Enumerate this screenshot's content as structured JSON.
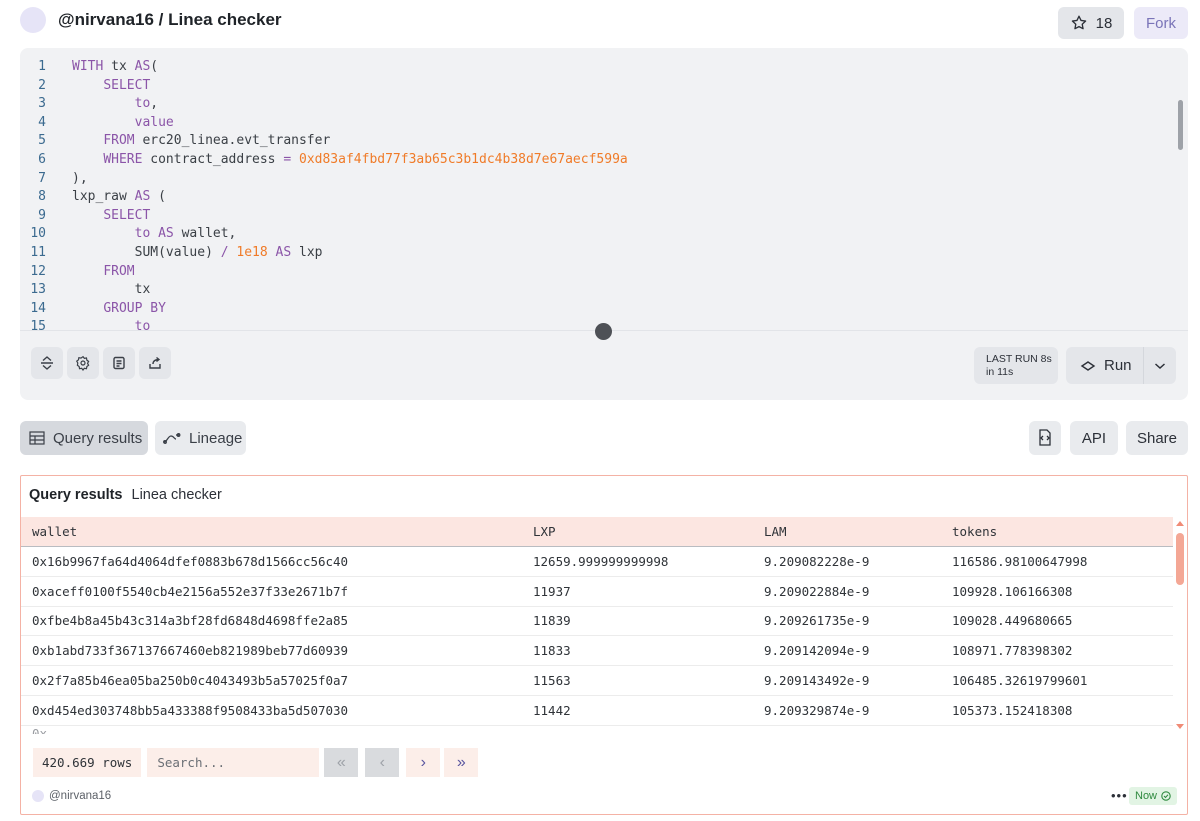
{
  "header": {
    "title": "@nirvana16 / Linea checker",
    "star_count": "18",
    "fork_label": "Fork"
  },
  "editor": {
    "lines": [
      {
        "n": "1",
        "parts": [
          {
            "t": "WITH",
            "c": "kw"
          },
          {
            "t": " tx ",
            "c": ""
          },
          {
            "t": "AS",
            "c": "kw"
          },
          {
            "t": "(",
            "c": ""
          }
        ]
      },
      {
        "n": "2",
        "parts": [
          {
            "t": "    ",
            "c": ""
          },
          {
            "t": "SELECT",
            "c": "kw"
          }
        ]
      },
      {
        "n": "3",
        "parts": [
          {
            "t": "        ",
            "c": ""
          },
          {
            "t": "to",
            "c": "kw"
          },
          {
            "t": ",",
            "c": ""
          }
        ]
      },
      {
        "n": "4",
        "parts": [
          {
            "t": "        ",
            "c": ""
          },
          {
            "t": "value",
            "c": "kw"
          }
        ]
      },
      {
        "n": "5",
        "parts": [
          {
            "t": "    ",
            "c": ""
          },
          {
            "t": "FROM",
            "c": "kw"
          },
          {
            "t": " erc20_linea.evt_transfer",
            "c": ""
          }
        ]
      },
      {
        "n": "6",
        "parts": [
          {
            "t": "    ",
            "c": ""
          },
          {
            "t": "WHERE",
            "c": "kw"
          },
          {
            "t": " contract_address ",
            "c": ""
          },
          {
            "t": "=",
            "c": "kw"
          },
          {
            "t": " ",
            "c": ""
          },
          {
            "t": "0xd83af4fbd77f3ab65c3b1dc4b38d7e67aecf599a",
            "c": "num"
          }
        ]
      },
      {
        "n": "7",
        "parts": [
          {
            "t": "),",
            "c": ""
          }
        ]
      },
      {
        "n": "8",
        "parts": [
          {
            "t": "lxp_raw ",
            "c": ""
          },
          {
            "t": "AS",
            "c": "kw"
          },
          {
            "t": " (",
            "c": ""
          }
        ]
      },
      {
        "n": "9",
        "parts": [
          {
            "t": "    ",
            "c": ""
          },
          {
            "t": "SELECT",
            "c": "kw"
          }
        ]
      },
      {
        "n": "10",
        "parts": [
          {
            "t": "        ",
            "c": ""
          },
          {
            "t": "to",
            "c": "kw"
          },
          {
            "t": " ",
            "c": ""
          },
          {
            "t": "AS",
            "c": "kw"
          },
          {
            "t": " wallet,",
            "c": ""
          }
        ]
      },
      {
        "n": "11",
        "parts": [
          {
            "t": "        ",
            "c": ""
          },
          {
            "t": "SUM(value) ",
            "c": ""
          },
          {
            "t": "/",
            "c": "kw"
          },
          {
            "t": " ",
            "c": ""
          },
          {
            "t": "1e18",
            "c": "num"
          },
          {
            "t": " ",
            "c": ""
          },
          {
            "t": "AS",
            "c": "kw"
          },
          {
            "t": " lxp",
            "c": ""
          }
        ]
      },
      {
        "n": "12",
        "parts": [
          {
            "t": "    ",
            "c": ""
          },
          {
            "t": "FROM",
            "c": "kw"
          }
        ]
      },
      {
        "n": "13",
        "parts": [
          {
            "t": "        tx",
            "c": ""
          }
        ]
      },
      {
        "n": "14",
        "parts": [
          {
            "t": "    ",
            "c": ""
          },
          {
            "t": "GROUP BY",
            "c": "kw"
          }
        ]
      },
      {
        "n": "15",
        "parts": [
          {
            "t": "        ",
            "c": ""
          },
          {
            "t": "to",
            "c": "kw"
          }
        ]
      }
    ],
    "last_run_line1": "LAST RUN 8s",
    "last_run_line2": "in 11s",
    "run_label": "Run"
  },
  "tabs": {
    "results_label": "Query results",
    "lineage_label": "Lineage",
    "api_label": "API",
    "share_label": "Share"
  },
  "results": {
    "title": "Query results",
    "name": "Linea checker",
    "columns": [
      "wallet",
      "LXP",
      "LAM",
      "tokens"
    ],
    "rows": [
      [
        "0x16b9967fa64d4064dfef0883b678d1566cc56c40",
        "12659.999999999998",
        "9.209082228e-9",
        "116586.98100647998"
      ],
      [
        "0xaceff0100f5540cb4e2156a552e37f33e2671b7f",
        "11937",
        "9.209022884e-9",
        "109928.106166308"
      ],
      [
        "0xfbe4b8a45b43c314a3bf28fd6848d4698ffe2a85",
        "11839",
        "9.209261735e-9",
        "109028.449680665"
      ],
      [
        "0xb1abd733f367137667460eb821989beb77d60939",
        "11833",
        "9.209142094e-9",
        "108971.778398302"
      ],
      [
        "0x2f7a85b46ea05ba250b0c4043493b5a57025f0a7",
        "11563",
        "9.209143492e-9",
        "106485.32619799601"
      ],
      [
        "0xd454ed303748bb5a433388f9508433ba5d507030",
        "11442",
        "9.209329874e-9",
        "105373.152418308"
      ]
    ],
    "row_count": "420.669 rows",
    "search_placeholder": "Search...",
    "owner": "@nirvana16",
    "status": "Now"
  }
}
